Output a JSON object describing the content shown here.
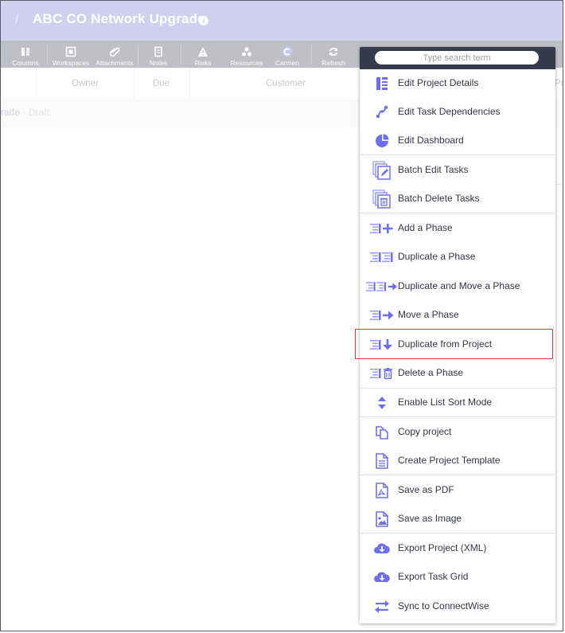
{
  "header": {
    "separator": "/",
    "project_title": "ABC CO Network Upgrade",
    "info_icon": "i"
  },
  "toolbar": {
    "items": [
      {
        "label": "Columns",
        "icon": "columns-icon"
      },
      {
        "label": "Workspaces",
        "icon": "workspaces-icon"
      },
      {
        "label": "Attachments",
        "icon": "paperclip-icon"
      },
      {
        "label": "Notes",
        "icon": "notes-icon"
      },
      {
        "label": "Risks",
        "icon": "warning-icon"
      },
      {
        "label": "Resources",
        "icon": "resources-icon"
      },
      {
        "label": "Carmen",
        "icon": "carmen-icon"
      },
      {
        "label": "Refresh",
        "icon": "refresh-icon"
      }
    ]
  },
  "grid": {
    "columns": [
      "Owner",
      "Due",
      "Customer",
      "Pro"
    ],
    "row1_text": "rade",
    "row1_muted": "- Draft"
  },
  "menu": {
    "search_placeholder": "Type search term",
    "items": [
      {
        "label": "Edit Project Details",
        "icon": "project-details-icon"
      },
      {
        "label": "Edit Task Dependencies",
        "icon": "dependencies-icon"
      },
      {
        "label": "Edit Dashboard",
        "icon": "pie-chart-icon"
      },
      {
        "label": "Batch Edit Tasks",
        "icon": "batch-edit-icon"
      },
      {
        "label": "Batch Delete Tasks",
        "icon": "batch-delete-icon"
      },
      {
        "label": "Add a Phase",
        "icon": "add-phase-icon"
      },
      {
        "label": "Duplicate a Phase",
        "icon": "duplicate-phase-icon"
      },
      {
        "label": "Duplicate and Move a Phase",
        "icon": "duplicate-move-phase-icon"
      },
      {
        "label": "Move a Phase",
        "icon": "move-phase-icon"
      },
      {
        "label": "Duplicate from Project",
        "icon": "duplicate-from-project-icon"
      },
      {
        "label": "Delete a Phase",
        "icon": "delete-phase-icon"
      },
      {
        "label": "Enable List Sort Mode",
        "icon": "sort-icon"
      },
      {
        "label": "Copy project",
        "icon": "copy-icon"
      },
      {
        "label": "Create Project Template",
        "icon": "template-icon"
      },
      {
        "label": "Save as PDF",
        "icon": "pdf-icon"
      },
      {
        "label": "Save as Image",
        "icon": "image-icon"
      },
      {
        "label": "Export Project (XML)",
        "icon": "cloud-download-icon"
      },
      {
        "label": "Export Task Grid",
        "icon": "cloud-download-icon"
      },
      {
        "label": "Sync to ConnectWise",
        "icon": "sync-icon"
      }
    ],
    "highlighted_index": 9
  },
  "colors": {
    "accent": "#6b6ff0",
    "menu_header": "#353a4d",
    "highlight_border": "#e53935"
  }
}
